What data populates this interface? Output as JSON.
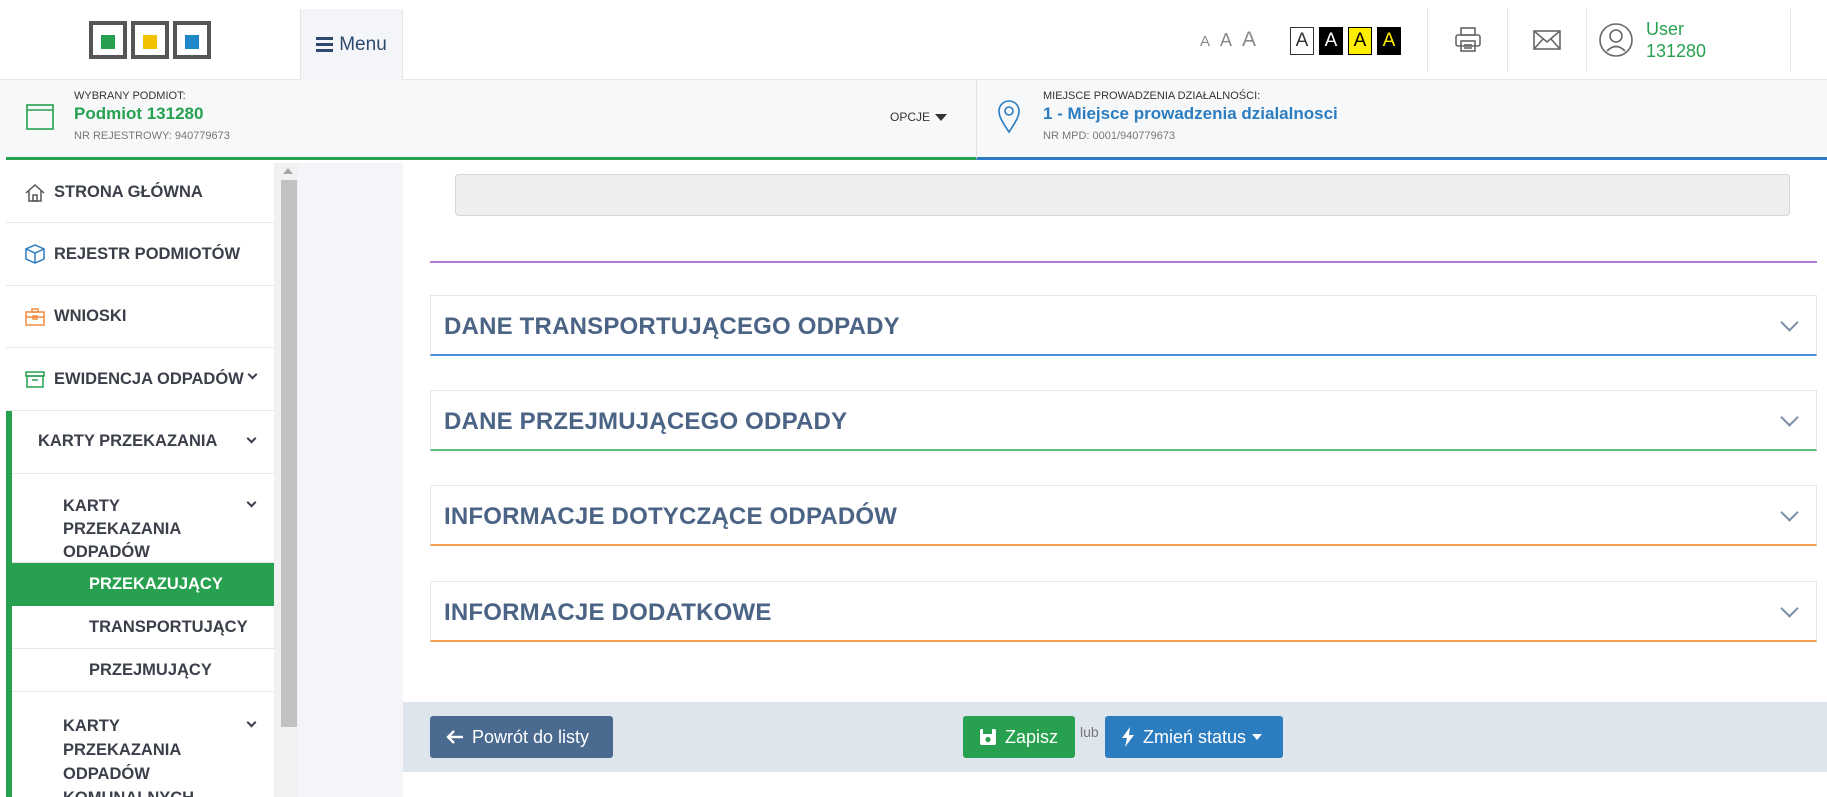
{
  "header": {
    "menu_label": "Menu",
    "font_sizes": [
      "A",
      "A",
      "A"
    ],
    "contrast_options": [
      "A",
      "A",
      "A",
      "A"
    ],
    "user_label": "User",
    "user_id": "131280"
  },
  "context": {
    "selected_label": "WYBRANY PODMIOT:",
    "selected_value": "Podmiot 131280",
    "registry_label": "NR REJESTROWY: 940779673",
    "options_label": "OPCJE",
    "place_label": "MIEJSCE PROWADZENIA DZIAŁALNOŚCI:",
    "place_value": "1 - Miejsce prowadzenia dzialalnosci",
    "mpd_label": "NR MPD: 0001/940779673"
  },
  "sidebar": {
    "items": [
      {
        "label": "STRONA GŁÓWNA",
        "icon": "home-icon"
      },
      {
        "label": "REJESTR PODMIOTÓW",
        "icon": "cube-icon"
      },
      {
        "label": "WNIOSKI",
        "icon": "briefcase-icon"
      },
      {
        "label": "EWIDENCJA ODPADÓW",
        "icon": "archive-icon"
      }
    ],
    "sub": {
      "karty": "KARTY PRZEKAZANIA",
      "karty_odpadow": "KARTY PRZEKAZANIA ODPADÓW",
      "przekazujacy": "PRZEKAZUJĄCY",
      "transportujacy": "TRANSPORTUJĄCY",
      "przejmujacy": "PRZEJMUJĄCY",
      "karty_komunalnych": "KARTY PRZEKAZANIA ODPADÓW KOMUNALNYCH"
    }
  },
  "main": {
    "panels": [
      {
        "title": "DANE TRANSPORTUJĄCEGO ODPADY",
        "accent": "#4a90d9"
      },
      {
        "title": "DANE PRZEJMUJĄCEGO ODPADY",
        "accent": "#5cbf7a"
      },
      {
        "title": "INFORMACJE DOTYCZĄCE ODPADÓW",
        "accent": "#f0a050"
      },
      {
        "title": "INFORMACJE DODATKOWE",
        "accent": "#f0a050"
      }
    ],
    "actions": {
      "back_label": "Powrót do listy",
      "save_label": "Zapisz",
      "or_label": "lub",
      "status_label": "Zmień status"
    }
  },
  "colors": {
    "brand_green": "#27a14f",
    "brand_blue": "#2c7cc0",
    "heading_blue": "#4b6485"
  }
}
